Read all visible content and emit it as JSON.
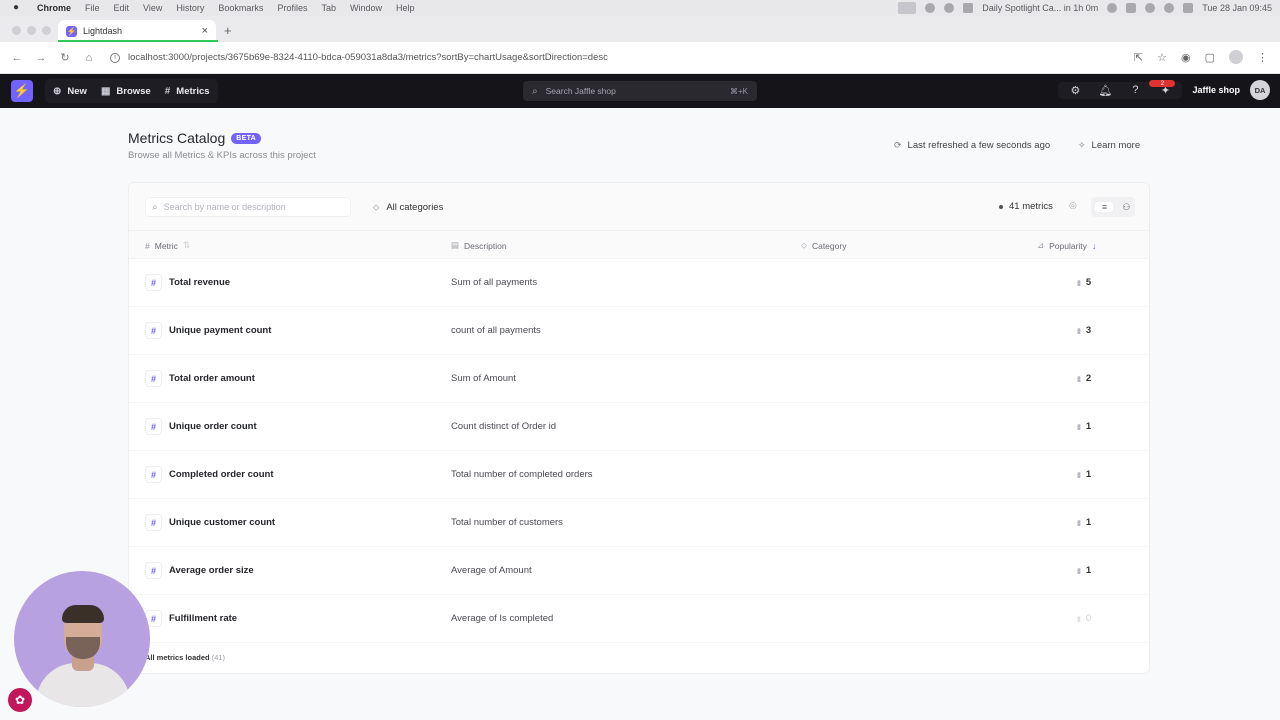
{
  "mac_menubar": {
    "app": "Chrome",
    "menus": [
      "File",
      "Edit",
      "View",
      "History",
      "Bookmarks",
      "Profiles",
      "Tab",
      "Window",
      "Help"
    ],
    "status_text": "Daily Spotlight Ca... in 1h 0m",
    "datetime": "Tue 28 Jan  09:45"
  },
  "browser": {
    "tab_title": "Lightdash",
    "url": "localhost:3000/projects/3675b69e-8324-4110-bdca-059031a8da3/metrics?sortBy=chartUsage&sortDirection=desc"
  },
  "header": {
    "new_label": "New",
    "browse_label": "Browse",
    "metrics_label": "Metrics",
    "search_placeholder": "Search Jaffle shop",
    "search_shortcut": "⌘+K",
    "notif_badge": "2",
    "project_name": "Jaffle shop",
    "avatar_initials": "DA"
  },
  "page": {
    "title": "Metrics Catalog",
    "badge": "BETA",
    "subtitle": "Browse all Metrics & KPIs across this project",
    "refreshed": "Last refreshed a few seconds ago",
    "learn_more": "Learn more"
  },
  "toolbar": {
    "search_placeholder": "Search by name or description",
    "category_filter": "All categories",
    "metric_count": "41 metrics"
  },
  "table": {
    "columns": {
      "metric": "Metric",
      "description": "Description",
      "category": "Category",
      "popularity": "Popularity"
    },
    "rows": [
      {
        "name": "Total revenue",
        "description": "Sum of all payments",
        "popularity": "5"
      },
      {
        "name": "Unique payment count",
        "description": "count of all payments",
        "popularity": "3"
      },
      {
        "name": "Total order amount",
        "description": "Sum of Amount",
        "popularity": "2"
      },
      {
        "name": "Unique order count",
        "description": "Count distinct of Order id",
        "popularity": "1"
      },
      {
        "name": "Completed order count",
        "description": "Total number of completed orders",
        "popularity": "1"
      },
      {
        "name": "Unique customer count",
        "description": "Total number of customers",
        "popularity": "1"
      },
      {
        "name": "Average order size",
        "description": "Average of Amount",
        "popularity": "1"
      },
      {
        "name": "Fulfillment rate",
        "description": "Average of Is completed",
        "popularity": "0"
      }
    ],
    "footer_label": "All metrics loaded",
    "footer_count": "(41)"
  },
  "colors": {
    "brand": "#7262ff",
    "header_bg": "#151419",
    "sort_active": "#4c6ef5"
  }
}
